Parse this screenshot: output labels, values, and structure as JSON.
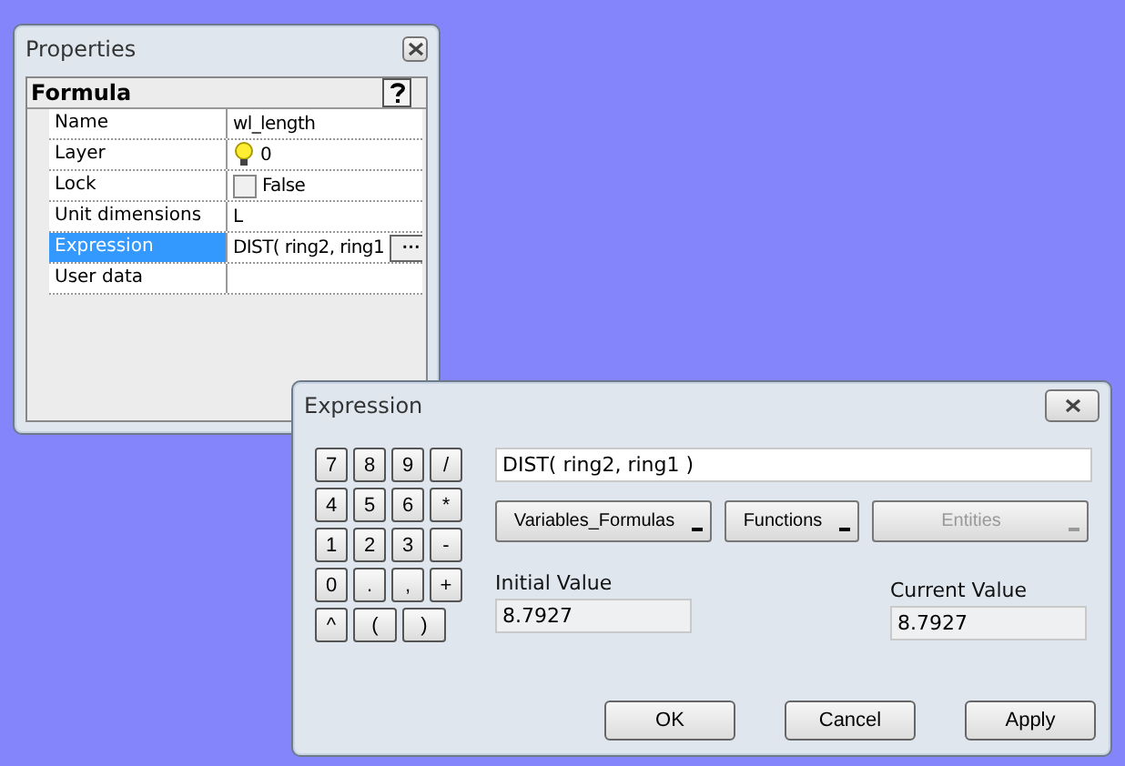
{
  "properties_panel": {
    "title": "Properties",
    "section": "Formula",
    "rows": [
      {
        "label": "Name",
        "value": "wl_length",
        "kind": "text",
        "selected": false
      },
      {
        "label": "Layer",
        "value": "0",
        "kind": "layer",
        "selected": false
      },
      {
        "label": "Lock",
        "value": "False",
        "kind": "checkbox",
        "checked": false,
        "selected": false
      },
      {
        "label": "Unit dimensions",
        "value": "L",
        "kind": "text",
        "selected": false
      },
      {
        "label": "Expression",
        "value": "DIST( ring2, ring1",
        "kind": "ellipsis",
        "button": "···",
        "selected": true
      },
      {
        "label": "User data",
        "value": "",
        "kind": "text",
        "selected": false
      }
    ]
  },
  "expression_dialog": {
    "title": "Expression",
    "keypad": [
      [
        "7",
        "8",
        "9",
        "/"
      ],
      [
        "4",
        "5",
        "6",
        "*"
      ],
      [
        "1",
        "2",
        "3",
        "-"
      ],
      [
        "0",
        ".",
        ",",
        "+"
      ],
      [
        "^",
        "(",
        ")"
      ]
    ],
    "expression": "DIST( ring2, ring1 )",
    "menus": [
      {
        "label": "Variables_Formulas",
        "disabled": false
      },
      {
        "label": "Functions",
        "disabled": false
      },
      {
        "label": "Entities",
        "disabled": true
      }
    ],
    "initial_label": "Initial Value",
    "initial_value": "8.7927",
    "current_label": "Current Value",
    "current_value": "8.7927",
    "buttons": [
      "OK",
      "Cancel",
      "Apply"
    ]
  }
}
